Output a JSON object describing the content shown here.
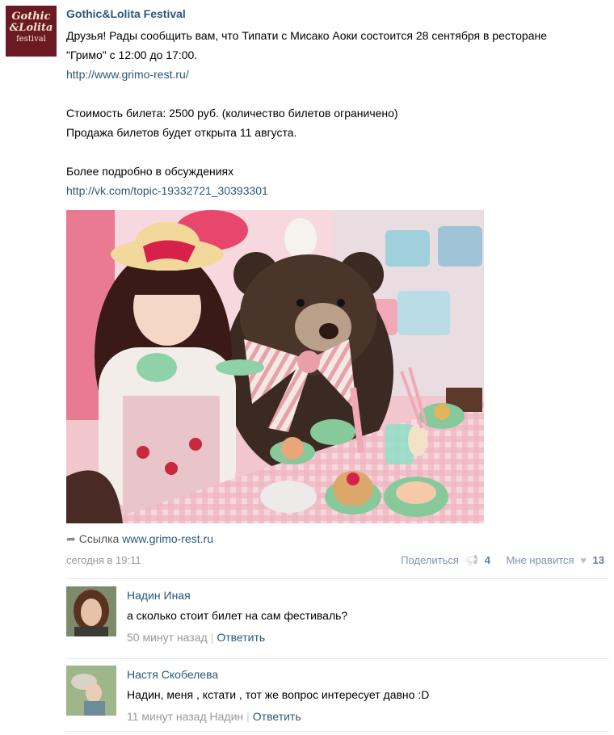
{
  "group": {
    "name": "Gothic&Lolita Festival",
    "logo_line1": "Gothic",
    "logo_line2": "&Lolita",
    "logo_line3": "festival"
  },
  "post": {
    "line1": "Друзья! Рады сообщить вам, что Типати с Мисако Аоки состоится 28 сентября в ресторане",
    "line2": "\"Гримо\" с 12:00 до 17:00.",
    "url1": "http://www.grimo-rest.ru/",
    "line3": "Стоимость билета: 2500 руб. (количество билетов ограничено)",
    "line4": "Продажа билетов будет открыта 11 августа.",
    "line5": "Более подробно в обсуждениях",
    "url2": "http://vk.com/topic-19332721_30393301",
    "share_prefix": "Ссылка",
    "share_url": "www.grimo-rest.ru",
    "date": "сегодня в 19:11",
    "share_label": "Поделиться",
    "share_count": "4",
    "like_label": "Мне нравится",
    "like_count": "13"
  },
  "comments": [
    {
      "author": "Надин Иная",
      "text": "а сколько стоит билет на сам фестиваль?",
      "time": "50 минут назад",
      "reply_to": "",
      "reply_label": "Ответить"
    },
    {
      "author": "Настя Скобелева",
      "text": "Надин, меня , кстати , тот же вопрос интересует давно :D",
      "time": "11 минут назад",
      "reply_to": "Надин",
      "reply_label": "Ответить"
    }
  ],
  "colors": {
    "link": "#2b587a",
    "muted": "#999999",
    "group_logo_bg": "#6b1a24"
  },
  "icons": {
    "share": "megaphone-icon",
    "like": "heart-icon",
    "link": "arrow-link-icon"
  }
}
